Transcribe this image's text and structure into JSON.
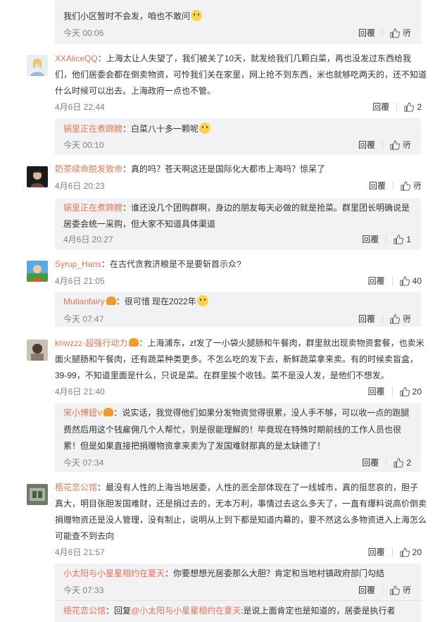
{
  "actions": {
    "reply": "回覆",
    "like_icon": "thumbs-up-icon"
  },
  "c0": {
    "reply": {
      "text": "我们小区暂时不会发，咱也不敢问",
      "time": "今天 00:06",
      "like": "𫠦"
    }
  },
  "c1": {
    "user": "XXAliceQQ",
    "text": "：上海太让人失望了，我们被关了10天，就发给我们几颗白菜，再也没发过东西给我们，他们居委会都在倒卖物资，可怜我们关在家里，网上抢不到东西，米也就够吃两天的，还不知道什么时候可以出去。上海政府一点也不管。",
    "time": "4月6日 22:44",
    "likes": "2",
    "reply": {
      "user": "锅里正在煮蹄膀",
      "text": "：白菜八十多一颗呢",
      "time": "今天 00:10",
      "like": "𫠦"
    }
  },
  "c2": {
    "user": "奶茶续命脱发致命",
    "text": "：真的吗？苍天啊这还是国际化大都市上海吗？惊呆了",
    "time": "4月6日 20:23",
    "like": "𫠦",
    "reply": {
      "user": "锅里正在煮蹄膀",
      "text": "：谁还没几个团购群啊，身边的朋友每天必做的就是抢菜。群里团长明确说是居委会统一采购，但大家不知道具体渠道",
      "time": "4月6日 20:27",
      "likes": "1"
    }
  },
  "c3": {
    "user": "Syrup_Hans",
    "text": "：在古代贪救济粮是不是要斩首示众?",
    "time": "4月6日 21:05",
    "likes": "40",
    "reply": {
      "user": "Mutianfairy",
      "text": "：很可惜 现在2022年",
      "time": "今天 07:47",
      "like": "𫠦"
    }
  },
  "c4": {
    "user": "knwzzz-超强行动力",
    "text": "：上海浦东，zf发了一小袋火腿肠和午餐肉，群里就出现卖物资套餐，也卖米面火腿肠和午餐肉，还有蔬菜种类更多。不怎么吃的发下去，新鲜蔬菜拿来卖。有的时候卖盲盒，39-99，不知道里面是什么，只说是菜。在群里挨个收钱。菜不是没人发，是他们不想发。",
    "time": "4月6日 21:40",
    "likes": "20",
    "reply": {
      "user": "宋小博妞",
      "text": "：说实话，我觉得他们如果分发物资觉得很累，没人手不够，可以收一点的跑腿费然后用这个钱雇佣几个人帮忙，到是很能理解的！毕竟现在特殊时期前线的工作人员也很累！但是如果直接把捐赠物资拿来卖为了发国难财那真的是太缺德了！",
      "time": "今天 07:34",
      "likes": "2"
    }
  },
  "c5": {
    "user": "梧花恋公馆",
    "text": "：最没有人性的上海当地居委，人性的恶全部体现在了一线城市，真的挺悲哀的，胆子真大，明目张胆发国难财，还是捐过去的，无本万利，事情过去这么多天了，一直有爆料说高价倒卖捐赠物资还是没人管理，没有制止，说明从上到下都是知道内幕的，要不然这么多物资进入上海怎么可能查不到去向",
    "time": "4月6日 21:57",
    "likes": "20",
    "reply": {
      "user": "小太阳与小星星相约在夏天",
      "text": "：你要想想光居委那么大胆？肯定和当地村镇政府部门勾结",
      "time": "今天 07:33",
      "like": "𫠦"
    },
    "reply2": {
      "user": "梧花恋公馆",
      "text_a": "：回复",
      "mention": "@小太阳与小星星相约在夏天",
      "text_b": ":是说上面肯定也是知道的，居委是执行者"
    }
  }
}
